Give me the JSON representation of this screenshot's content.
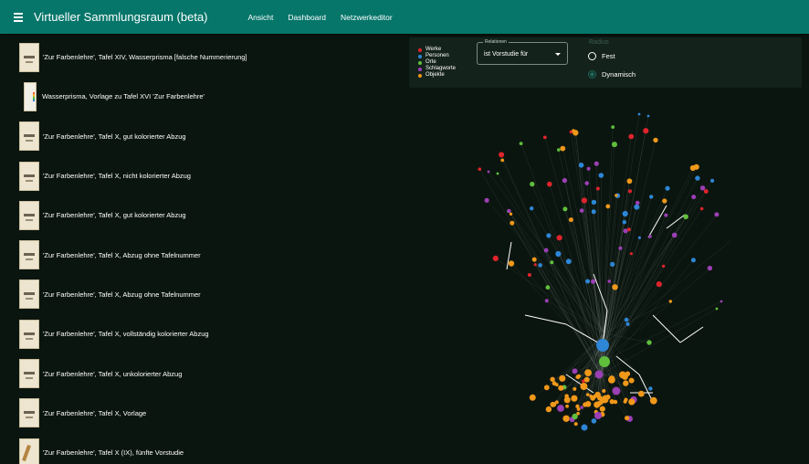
{
  "appbar": {
    "title": "Virtueller Sammlungsraum (beta)",
    "nav": [
      "Ansicht",
      "Dashboard",
      "Netzwerkeditor"
    ]
  },
  "items": [
    {
      "label": "'Zur Farbenlehre', Tafel XIV, Wasserprisma [falsche Nummerierung]",
      "thumb": "plate"
    },
    {
      "label": "Wasserprisma, Vorlage zu Tafel XVI 'Zur Farbenlehre'",
      "thumb": "prism"
    },
    {
      "label": "'Zur Farbenlehre', Tafel X, gut kolorierter Abzug",
      "thumb": "plate"
    },
    {
      "label": "'Zur Farbenlehre', Tafel X, nicht kolorierter Abzug",
      "thumb": "plate"
    },
    {
      "label": "'Zur Farbenlehre', Tafel X, gut kolorierter Abzug",
      "thumb": "plate"
    },
    {
      "label": "'Zur Farbenlehre', Tafel X, Abzug ohne Tafelnummer",
      "thumb": "plate"
    },
    {
      "label": "'Zur Farbenlehre', Tafel X, Abzug ohne Tafelnummer",
      "thumb": "plate"
    },
    {
      "label": "'Zur Farbenlehre', Tafel X, vollständig kolorierter Abzug",
      "thumb": "plate"
    },
    {
      "label": "'Zur Farbenlehre', Tafel X, unkolorierter Abzug",
      "thumb": "plate"
    },
    {
      "label": "'Zur Farbenlehre', Tafel X, Vorlage",
      "thumb": "plate"
    },
    {
      "label": "'Zur Farbenlehre', Tafel X (IX), fünfte Vorstudie",
      "thumb": "sketch"
    }
  ],
  "legend": [
    {
      "label": "Werke",
      "color": "#e0242c"
    },
    {
      "label": "Personen",
      "color": "#2d86d6"
    },
    {
      "label": "Orte",
      "color": "#5fbf3c"
    },
    {
      "label": "Schlagworte",
      "color": "#9b3fb5"
    },
    {
      "label": "Objekte",
      "color": "#f0981a"
    }
  ],
  "relations": {
    "label": "Relationen",
    "value": "ist Vorstudie für"
  },
  "radius": {
    "label": "Radius",
    "options": [
      "Fest",
      "Dynamisch"
    ],
    "selected": "Dynamisch"
  },
  "colors": {
    "appbar": "#06766a",
    "background": "#0b150f",
    "edge": "#9aa7a1",
    "highlight_edge": "#ffffff"
  }
}
